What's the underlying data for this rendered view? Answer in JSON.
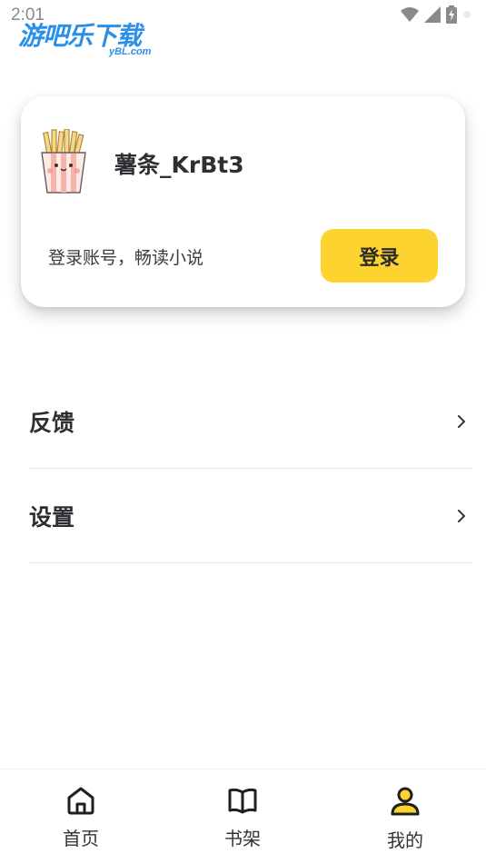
{
  "status_bar": {
    "time": "2:01",
    "icons": [
      "wifi-icon",
      "signal-icon",
      "battery-icon"
    ]
  },
  "watermark": {
    "main": "游吧乐下载",
    "sub": "yBL.com",
    "color": "#2a8fe8"
  },
  "profile": {
    "avatar_icon": "fries-avatar-icon",
    "username": "薯条_KrBt3",
    "login_hint": "登录账号，畅读小说",
    "login_button": "登录",
    "accent_color": "#fdd42f"
  },
  "menu": {
    "items": [
      {
        "label": "反馈",
        "icon": "chevron-right-icon"
      },
      {
        "label": "设置",
        "icon": "chevron-right-icon"
      }
    ]
  },
  "bottom_nav": {
    "items": [
      {
        "label": "首页",
        "icon": "home-icon"
      },
      {
        "label": "书架",
        "icon": "book-icon"
      },
      {
        "label": "我的",
        "icon": "user-icon",
        "active": true
      }
    ],
    "active_color": "#fdd42f"
  }
}
